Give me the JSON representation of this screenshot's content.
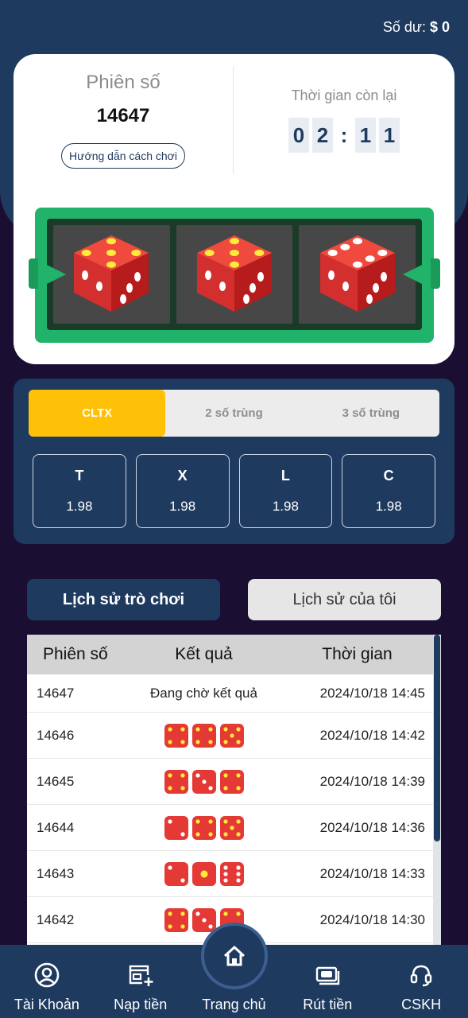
{
  "header": {
    "balance_label": "Số dư:",
    "balance_value": "$ 0"
  },
  "session": {
    "label": "Phiên số",
    "number": "14647",
    "guide_button": "Hướng dẫn cách chơi",
    "time_label": "Thời gian còn lại",
    "timer_digits": [
      "0",
      "2",
      "1",
      "1"
    ],
    "timer_separator": ":"
  },
  "dice_result": [
    {
      "face": 5,
      "pip_color": "yellow"
    },
    {
      "face": 5,
      "pip_color": "yellow"
    },
    {
      "face": 6,
      "pip_color": "white"
    }
  ],
  "bet": {
    "tabs": [
      {
        "label": "CLTX",
        "active": true
      },
      {
        "label": "2 số trùng",
        "active": false
      },
      {
        "label": "3 số trùng",
        "active": false
      }
    ],
    "options": [
      {
        "name": "T",
        "rate": "1.98"
      },
      {
        "name": "X",
        "rate": "1.98"
      },
      {
        "name": "L",
        "rate": "1.98"
      },
      {
        "name": "C",
        "rate": "1.98"
      }
    ]
  },
  "history": {
    "tab_game": "Lịch sử trò chơi",
    "tab_mine": "Lịch sử của tôi",
    "columns": [
      "Phiên số",
      "Kết quả",
      "Thời gian"
    ],
    "rows": [
      {
        "session": "14647",
        "result_text": "Đang chờ kết quả",
        "dice": [],
        "time": "2024/10/18 14:45"
      },
      {
        "session": "14646",
        "dice": [
          4,
          4,
          5
        ],
        "time": "2024/10/18 14:42"
      },
      {
        "session": "14645",
        "dice": [
          4,
          3,
          4
        ],
        "time": "2024/10/18 14:39"
      },
      {
        "session": "14644",
        "dice": [
          2,
          4,
          5
        ],
        "time": "2024/10/18 14:36"
      },
      {
        "session": "14643",
        "dice": [
          2,
          1,
          6
        ],
        "time": "2024/10/18 14:33"
      },
      {
        "session": "14642",
        "dice": [
          4,
          3,
          4
        ],
        "time": "2024/10/18 14:30"
      }
    ]
  },
  "nav": [
    {
      "label": "Tài Khoản",
      "icon": "user-circle-icon"
    },
    {
      "label": "Nạp tiền",
      "icon": "store-add-icon"
    },
    {
      "label": "Trang chủ",
      "icon": "home-icon"
    },
    {
      "label": "Rút tiền",
      "icon": "wallet-icon"
    },
    {
      "label": "CSKH",
      "icon": "headset-icon"
    }
  ],
  "colors": {
    "primary": "#1e3a5f",
    "accent": "#ffc107",
    "machine_green": "#21b36a",
    "dice_red": "#e53935"
  }
}
